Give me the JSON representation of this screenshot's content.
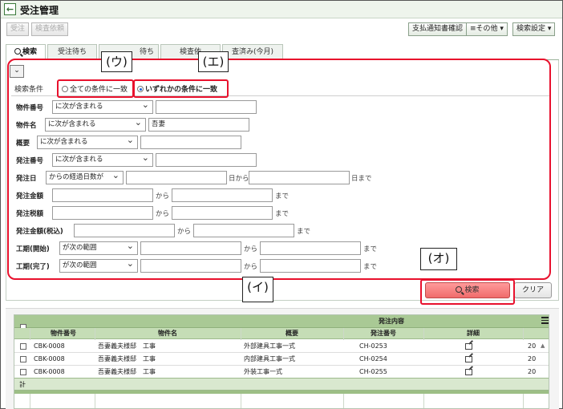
{
  "window": {
    "title": "受注管理"
  },
  "toolbar": {
    "order_btn": "受注",
    "inspection_request_btn": "検査依頼",
    "payment_notice_btn": "支払通知書確認",
    "other_btn": "≡その他 ▾",
    "search_settings_btn": "検索設定 ▾"
  },
  "tabs": [
    "検索",
    "受注待ち",
    "待ち",
    "検査依",
    "査済み(今月)"
  ],
  "search": {
    "collapse": "⌄",
    "cond_legend": "検索条件",
    "match_all": "全ての条件に一致",
    "match_any": "いずれかの条件に一致",
    "rows": {
      "bukken_no": {
        "label": "物件番号",
        "op": "に次が含まれる",
        "value": ""
      },
      "bukken_name": {
        "label": "物件名",
        "op": "に次が含まれる",
        "value": "吾妻"
      },
      "summary": {
        "label": "概要",
        "op": "に次が含まれる",
        "value": ""
      },
      "order_no": {
        "label": "発注番号",
        "op": "に次が含まれる",
        "value": ""
      },
      "order_date": {
        "label": "発注日",
        "op": "からの経過日数が",
        "from_sep": "日から",
        "to_sep": "日まで"
      },
      "amount": {
        "label": "発注金額",
        "from_sep": "から",
        "to_sep": "まで"
      },
      "tax": {
        "label": "発注税額",
        "from_sep": "から",
        "to_sep": "まで"
      },
      "amount_tax": {
        "label": "発注金額(税込)",
        "from_sep": "から",
        "to_sep": "まで"
      },
      "term_start": {
        "label": "工期(開始)",
        "op": "が次の範囲",
        "from_sep": "から",
        "to_sep": "まで"
      },
      "term_end": {
        "label": "工期(完了)",
        "op": "が次の範囲",
        "from_sep": "から",
        "to_sep": "まで"
      }
    },
    "search_btn": "検索",
    "clear_btn": "クリア"
  },
  "annotations": {
    "u": "(ウ)",
    "e": "(エ)",
    "i": "(イ)",
    "o": "(オ)"
  },
  "grid": {
    "group_header": "発注内容",
    "columns": [
      "物件番号",
      "物件名",
      "概要",
      "発注番号",
      "詳細"
    ],
    "rows": [
      {
        "bukken_no": "CBK-0008",
        "bukken_name": "吾妻義夫様邸　工事",
        "summary": "外部建具工事一式",
        "order_no": "CH-0253",
        "trail": "20"
      },
      {
        "bukken_no": "CBK-0008",
        "bukken_name": "吾妻義夫様邸　工事",
        "summary": "内部建具工事一式",
        "order_no": "CH-0254",
        "trail": "20"
      },
      {
        "bukken_no": "CBK-0008",
        "bukken_name": "吾妻義夫様邸　工事",
        "summary": "外装工事一式",
        "order_no": "CH-0255",
        "trail": "20"
      }
    ],
    "total_label": "計"
  }
}
